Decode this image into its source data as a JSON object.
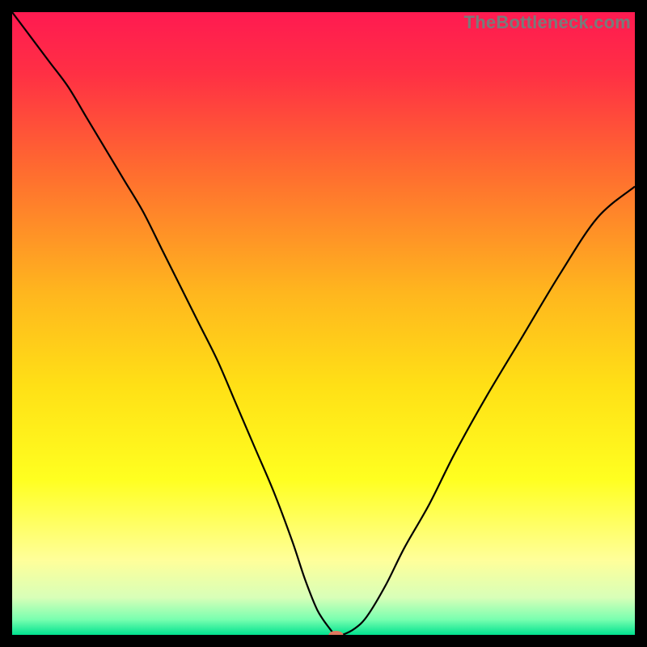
{
  "watermark": "TheBottleneck.com",
  "chart_data": {
    "type": "line",
    "title": "",
    "xlabel": "",
    "ylabel": "",
    "xlim": [
      0,
      100
    ],
    "ylim": [
      0,
      100
    ],
    "background_gradient": {
      "stops": [
        {
          "offset": 0.0,
          "color": "#ff1a51"
        },
        {
          "offset": 0.1,
          "color": "#ff3044"
        },
        {
          "offset": 0.25,
          "color": "#ff6a30"
        },
        {
          "offset": 0.45,
          "color": "#ffb61e"
        },
        {
          "offset": 0.6,
          "color": "#ffe016"
        },
        {
          "offset": 0.75,
          "color": "#ffff20"
        },
        {
          "offset": 0.88,
          "color": "#ffff9a"
        },
        {
          "offset": 0.94,
          "color": "#d8ffb8"
        },
        {
          "offset": 0.975,
          "color": "#7affb0"
        },
        {
          "offset": 1.0,
          "color": "#00e28f"
        }
      ]
    },
    "series": [
      {
        "name": "bottleneck-curve",
        "color": "#000000",
        "width": 2.2,
        "x": [
          0,
          3,
          6,
          9,
          12,
          15,
          18,
          21,
          24,
          27,
          30,
          33,
          36,
          39,
          42,
          45,
          47,
          49,
          51,
          52,
          53,
          55,
          57,
          60,
          63,
          67,
          71,
          76,
          82,
          88,
          94,
          100
        ],
        "y": [
          100,
          96,
          92,
          88,
          83,
          78,
          73,
          68,
          62,
          56,
          50,
          44,
          37,
          30,
          23,
          15,
          9,
          4,
          1,
          0,
          0,
          1,
          3,
          8,
          14,
          21,
          29,
          38,
          48,
          58,
          67,
          72
        ]
      }
    ],
    "marker": {
      "name": "optimal-point",
      "x": 52,
      "y": 0,
      "color": "#e07860",
      "rx": 9,
      "ry": 5
    }
  }
}
